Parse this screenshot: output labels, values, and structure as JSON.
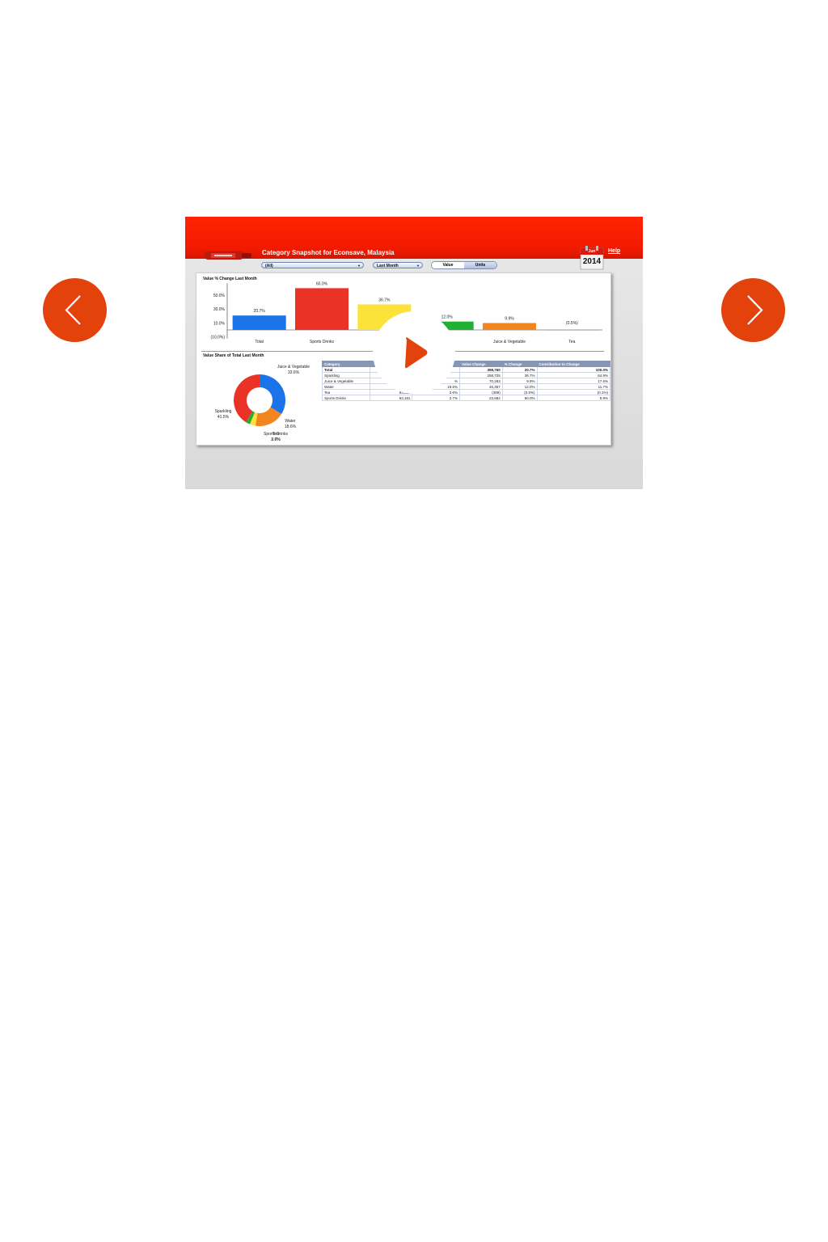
{
  "carousel": {
    "prev_icon": "chevron-left-icon",
    "next_icon": "chevron-right-icon",
    "accent_color": "#e3420d"
  },
  "video": {
    "play_icon": "play-icon",
    "play_color": "#e3420d"
  },
  "app": {
    "title": "Category Snapshot for Econsave, Malaysia",
    "help": "Help",
    "calendar": {
      "month": "Jun",
      "year": "2014"
    },
    "filters": {
      "category": "(All)",
      "period": "Last Month"
    },
    "toggle": [
      "Value",
      "Units"
    ],
    "header_color": "#ff2400"
  },
  "bar_chart": {
    "title": "Value % Change Last Month",
    "chart_data": {
      "type": "bar",
      "categories": [
        "Total",
        "Sports Drinks",
        "Sparkling",
        "Water",
        "Juice & Vegetable",
        "Tea"
      ],
      "visible_labels": [
        "Total",
        "Sports Drinks",
        "",
        "",
        "Juice & Vegetable",
        "Tea"
      ],
      "values": [
        20.7,
        60.0,
        36.7,
        12.0,
        9.9,
        -0.5
      ],
      "value_labels": [
        "20.7%",
        "60.0%",
        "36.7%",
        "12.0%",
        "9.9%",
        "(0.5%)"
      ],
      "colors": [
        "#1a73e8",
        "#ea3326",
        "#fbe33a",
        "#22b034",
        "#f2851d",
        "#9a9a9a"
      ],
      "y_ticks": [
        "50.0%",
        "30.0%",
        "10.0%",
        "(10.0%)"
      ],
      "y_tick_values": [
        50,
        30,
        10,
        -10
      ],
      "ylim": [
        -10,
        60
      ]
    }
  },
  "share_chart": {
    "title": "Value Share of Total Last Month",
    "chart_data": {
      "type": "pie",
      "slices": [
        {
          "label": "Juice & Vegetable",
          "value": 33.6,
          "text": "33.6%",
          "color": "#1a73e8"
        },
        {
          "label": "Water",
          "value": 18.6,
          "text": "18.6%",
          "color": "#f2851d"
        },
        {
          "label": "Tea",
          "value": 3.6,
          "text": "3.6%",
          "color": "#fbe33a"
        },
        {
          "label": "Sports Drinks",
          "value": 2.7,
          "text": "2.7%",
          "color": "#22b034"
        },
        {
          "label": "Sparkling",
          "value": 41.5,
          "text": "41.5%",
          "color": "#ea3326"
        }
      ]
    }
  },
  "table": {
    "headers": [
      "Category",
      "",
      "",
      "Value Change",
      "% Change",
      "Contribution to Change"
    ],
    "rows": [
      [
        "Total",
        "",
        "",
        "398,760",
        "20.7%",
        "100.0%"
      ],
      [
        "Sparkling",
        "",
        "",
        "258,725",
        "36.7%",
        "64.9%"
      ],
      [
        "Juice & Vegetable",
        "",
        "%",
        "70,283",
        "9.9%",
        "17.6%"
      ],
      [
        "Water",
        "43",
        "18.6%",
        "46,457",
        "12.0%",
        "11.7%"
      ],
      [
        "Tea",
        "83,515",
        "3.6%",
        "(389)",
        "(0.5%)",
        "(0.1%)"
      ],
      [
        "Sports Drinks",
        "63,181",
        "2.7%",
        "23,684",
        "60.0%",
        "5.9%"
      ]
    ]
  }
}
